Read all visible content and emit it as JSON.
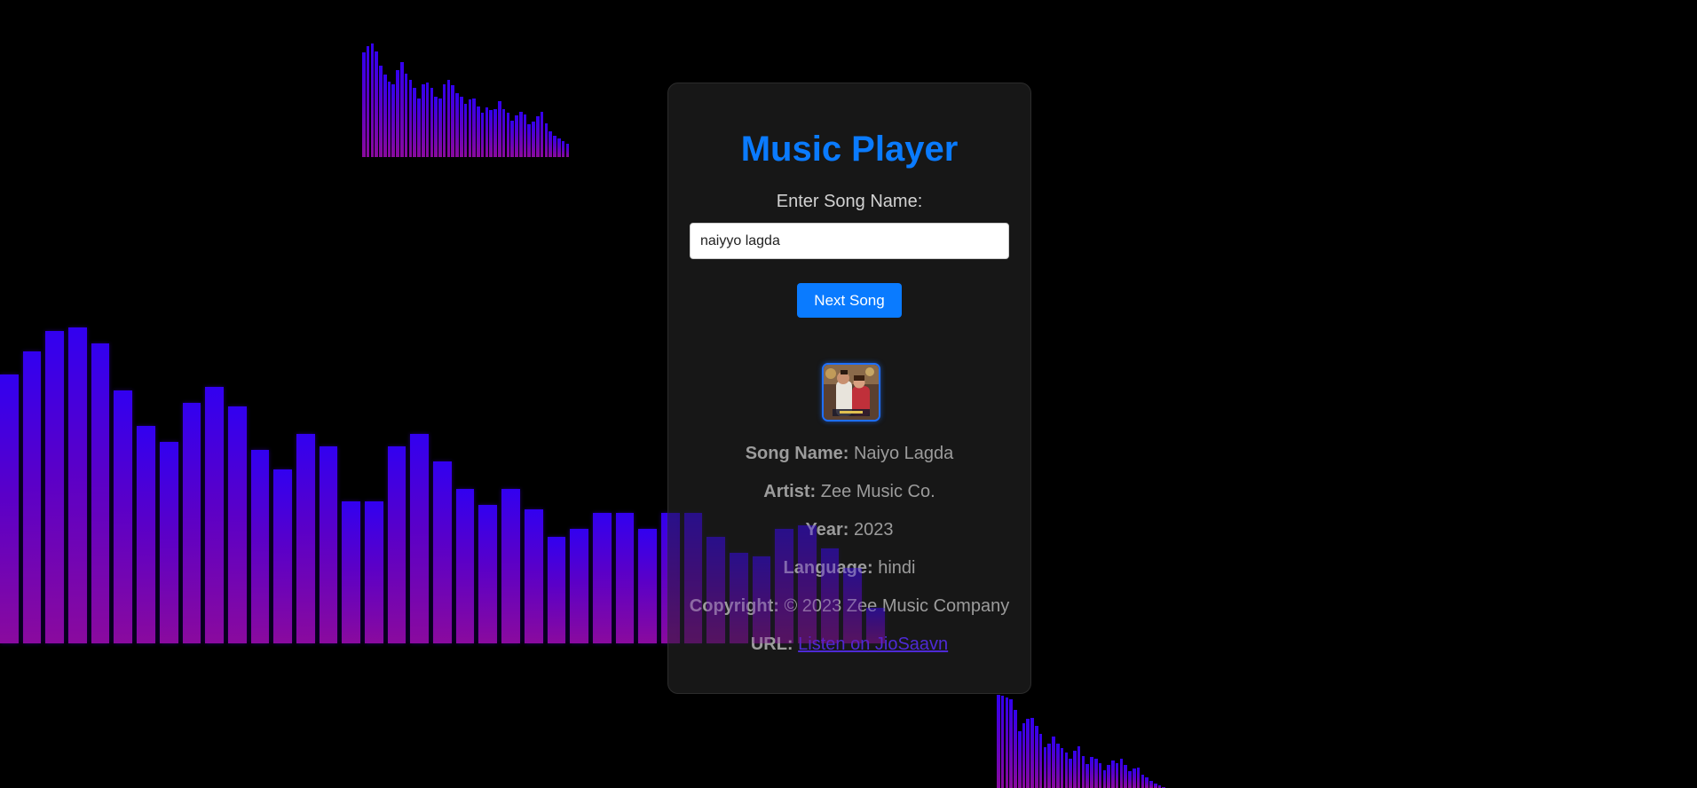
{
  "player": {
    "title": "Music Player",
    "input_label": "Enter Song Name:",
    "input_value": "naiyyo lagda",
    "next_button_label": "Next Song"
  },
  "song": {
    "name_label": "Song Name:",
    "name_value": "Naiyo Lagda",
    "artist_label": "Artist:",
    "artist_value": "Zee Music Co.",
    "year_label": "Year:",
    "year_value": "2023",
    "language_label": "Language:",
    "language_value": "hindi",
    "copyright_label": "Copyright:",
    "copyright_value": "© 2023 Zee Music Company",
    "url_label": "URL:",
    "url_text": "Listen on JioSaavn"
  },
  "colors": {
    "accent": "#0a7bff",
    "background": "#000000",
    "card": "#1a1a1a",
    "visualizer_top": "#3200f0",
    "visualizer_bottom": "#8a0a9e",
    "link": "#4e2ad6"
  },
  "visualizers": {
    "left_levels": [
      0.68,
      0.74,
      0.79,
      0.8,
      0.76,
      0.64,
      0.55,
      0.51,
      0.61,
      0.65,
      0.6,
      0.49,
      0.44,
      0.53,
      0.5,
      0.36,
      0.36,
      0.5,
      0.53,
      0.46,
      0.39,
      0.35,
      0.39,
      0.34,
      0.27,
      0.29,
      0.33,
      0.33,
      0.29,
      0.33,
      0.33,
      0.27,
      0.23,
      0.22,
      0.29,
      0.3,
      0.24,
      0.19,
      0.09
    ],
    "top_levels": [
      0.8,
      0.85,
      0.87,
      0.81,
      0.7,
      0.63,
      0.58,
      0.56,
      0.67,
      0.73,
      0.64,
      0.59,
      0.53,
      0.45,
      0.56,
      0.57,
      0.53,
      0.46,
      0.45,
      0.56,
      0.59,
      0.55,
      0.49,
      0.46,
      0.41,
      0.44,
      0.45,
      0.39,
      0.34,
      0.38,
      0.36,
      0.37,
      0.43,
      0.37,
      0.34,
      0.28,
      0.32,
      0.35,
      0.33,
      0.25,
      0.27,
      0.31,
      0.35,
      0.26,
      0.2,
      0.16,
      0.14,
      0.12,
      0.1
    ],
    "bottom_levels": [
      0.82,
      0.81,
      0.8,
      0.78,
      0.69,
      0.5,
      0.57,
      0.61,
      0.62,
      0.55,
      0.48,
      0.36,
      0.39,
      0.45,
      0.39,
      0.35,
      0.31,
      0.26,
      0.33,
      0.37,
      0.28,
      0.21,
      0.27,
      0.26,
      0.22,
      0.16,
      0.2,
      0.24,
      0.22,
      0.26,
      0.2,
      0.15,
      0.17,
      0.18,
      0.12,
      0.09,
      0.06,
      0.04,
      0.02,
      0.01
    ]
  }
}
